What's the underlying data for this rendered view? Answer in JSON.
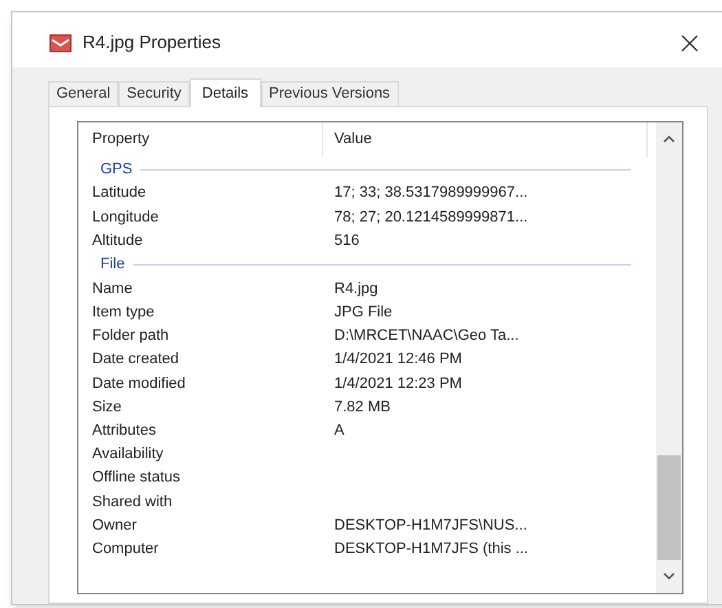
{
  "window": {
    "title": "R4.jpg Properties"
  },
  "tabs": [
    {
      "label": "General",
      "selected": false
    },
    {
      "label": "Security",
      "selected": false
    },
    {
      "label": "Details",
      "selected": true
    },
    {
      "label": "Previous Versions",
      "selected": false
    }
  ],
  "table": {
    "columns": [
      "Property",
      "Value"
    ],
    "rows": [
      {
        "kind": "group",
        "label": "GPS"
      },
      {
        "kind": "row",
        "property": "Latitude",
        "value": "17; 33; 38.5317989999967..."
      },
      {
        "kind": "row",
        "property": "Longitude",
        "value": "78; 27; 20.1214589999871..."
      },
      {
        "kind": "row",
        "property": "Altitude",
        "value": "516"
      },
      {
        "kind": "group",
        "label": "File"
      },
      {
        "kind": "row",
        "property": "Name",
        "value": "R4.jpg"
      },
      {
        "kind": "row",
        "property": "Item type",
        "value": "JPG File"
      },
      {
        "kind": "row",
        "property": "Folder path",
        "value": "D:\\MRCET\\NAAC\\Geo Ta..."
      },
      {
        "kind": "row",
        "property": "Date created",
        "value": "1/4/2021 12:46 PM"
      },
      {
        "kind": "row",
        "property": "Date modified",
        "value": "1/4/2021 12:23 PM"
      },
      {
        "kind": "row",
        "property": "Size",
        "value": "7.82 MB"
      },
      {
        "kind": "row",
        "property": "Attributes",
        "value": "A"
      },
      {
        "kind": "row",
        "property": "Availability"
      },
      {
        "kind": "row",
        "property": "Offline status"
      },
      {
        "kind": "row",
        "property": "Shared with"
      },
      {
        "kind": "row",
        "property": "Owner",
        "value": "DESKTOP-H1M7JFS\\NUS..."
      },
      {
        "kind": "row",
        "property": "Computer",
        "value": "DESKTOP-H1M7JFS (this ..."
      }
    ]
  }
}
